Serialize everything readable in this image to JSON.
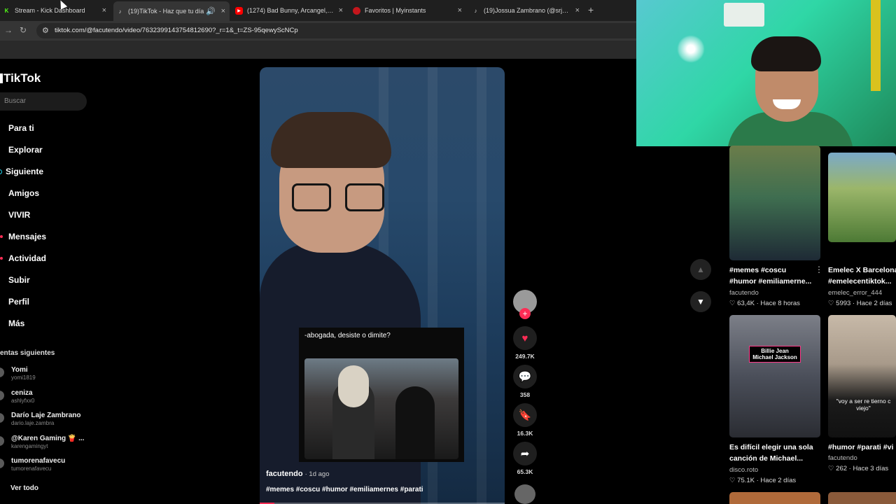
{
  "browser": {
    "tabs": [
      {
        "title": "Stream - Kick Dashboard",
        "icon": "kick-icon"
      },
      {
        "title": "(19)TikTok - Haz que tu día",
        "icon": "tiktok-icon",
        "active": true
      },
      {
        "title": "(1274) Bad Bunny, Arcangel, De",
        "icon": "youtube-icon"
      },
      {
        "title": "Favoritos | Myinstants",
        "icon": "myinstants-icon"
      },
      {
        "title": "(19)Jossua Zambrano (@srjossu",
        "icon": "tiktok-icon"
      }
    ],
    "new_tab": "+",
    "url": "tiktok.com/@facutendo/video/7632399143754812690?_r=1&_t=ZS-95qewyScNCp"
  },
  "sidebar": {
    "logo": "TikTok",
    "search_placeholder": "Buscar",
    "nav": [
      {
        "label": "Para ti",
        "marker": "none"
      },
      {
        "label": "Explorar",
        "marker": "none"
      },
      {
        "label": "Siguiente",
        "marker": "ring"
      },
      {
        "label": "Amigos",
        "marker": "none"
      },
      {
        "label": "VIVIR",
        "marker": "none"
      },
      {
        "label": "Mensajes",
        "marker": "red"
      },
      {
        "label": "Actividad",
        "marker": "red"
      },
      {
        "label": "Subir",
        "marker": "none"
      },
      {
        "label": "Perfil",
        "marker": "none"
      },
      {
        "label": "Más",
        "marker": "none"
      }
    ],
    "following_header": "entas siguientes",
    "accounts": [
      {
        "name": "Yomi",
        "handle": "yomi1819"
      },
      {
        "name": "ceniza",
        "handle": "ashlyfxx0"
      },
      {
        "name": "Darío Laje Zambrano",
        "handle": "dario.laje.zambra"
      },
      {
        "name": "@Karen Gaming 🍟 ...",
        "handle": "karengamingyt"
      },
      {
        "name": "tumorenafavecu",
        "handle": "tumorenafavecu"
      }
    ],
    "see_all": "Ver todo"
  },
  "video": {
    "caption": "-abogada, desiste o dimite?",
    "author": "facutendo",
    "time_ago": "· 1d ago",
    "hashtags": "#memes #coscu #humor #emiliamernes #parati",
    "progress": 0.06,
    "actions": {
      "likes": "249.7K",
      "comments": "358",
      "saves": "16.3K",
      "shares": "65.3K"
    },
    "follow_plus": "+"
  },
  "right_grid": {
    "cards": [
      {
        "title1": "#memes #coscu",
        "title2": "#humor #emiliamerne...",
        "user": "facutendo",
        "meta": "♡ 63,4K · Hace 8 horas"
      },
      {
        "title1": "Emelec X Barcelona",
        "title2": "#emelecentiktok...",
        "user": "emelec_error_444",
        "meta": "♡ 5993 · Hace 2 días"
      },
      {
        "title1": "Es difícil elegir una sola",
        "title2": "canción de Michael...",
        "user": "disco.roto",
        "meta": "♡ 75.1K · Hace 2 días",
        "overlay": "Billie Jean Michael Jackson"
      },
      {
        "title1": "#humor #parati #vi",
        "title2": "",
        "user": "facutendo",
        "meta": "♡ 262 · Hace 3 días",
        "overlay": "\"voy a ser re tierno c viejo\""
      }
    ]
  }
}
